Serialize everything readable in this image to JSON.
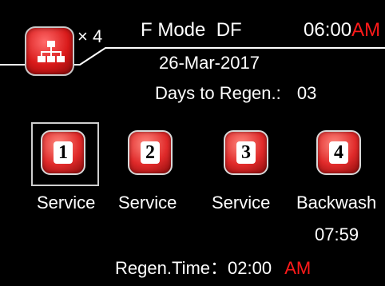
{
  "header": {
    "units_multiplier": "× 4",
    "mode": "F Mode  DF",
    "clock": {
      "time": "06:00",
      "ampm": "AM"
    },
    "date": "26-Mar-2017",
    "days_to_regen": {
      "label": "Days to Regen.:",
      "value": "03"
    }
  },
  "valves": [
    {
      "number": "1",
      "status": "Service"
    },
    {
      "number": "2",
      "status": "Service"
    },
    {
      "number": "3",
      "status": "Service"
    },
    {
      "number": "4",
      "status": "Backwash",
      "timer": "07:59"
    }
  ],
  "regen_time": {
    "label": "Regen.Time：",
    "time": "02:00",
    "ampm": "AM"
  },
  "colors": {
    "accent_red": "#ff1a1a",
    "tile_red": "#e02a2a",
    "background": "#000000"
  }
}
